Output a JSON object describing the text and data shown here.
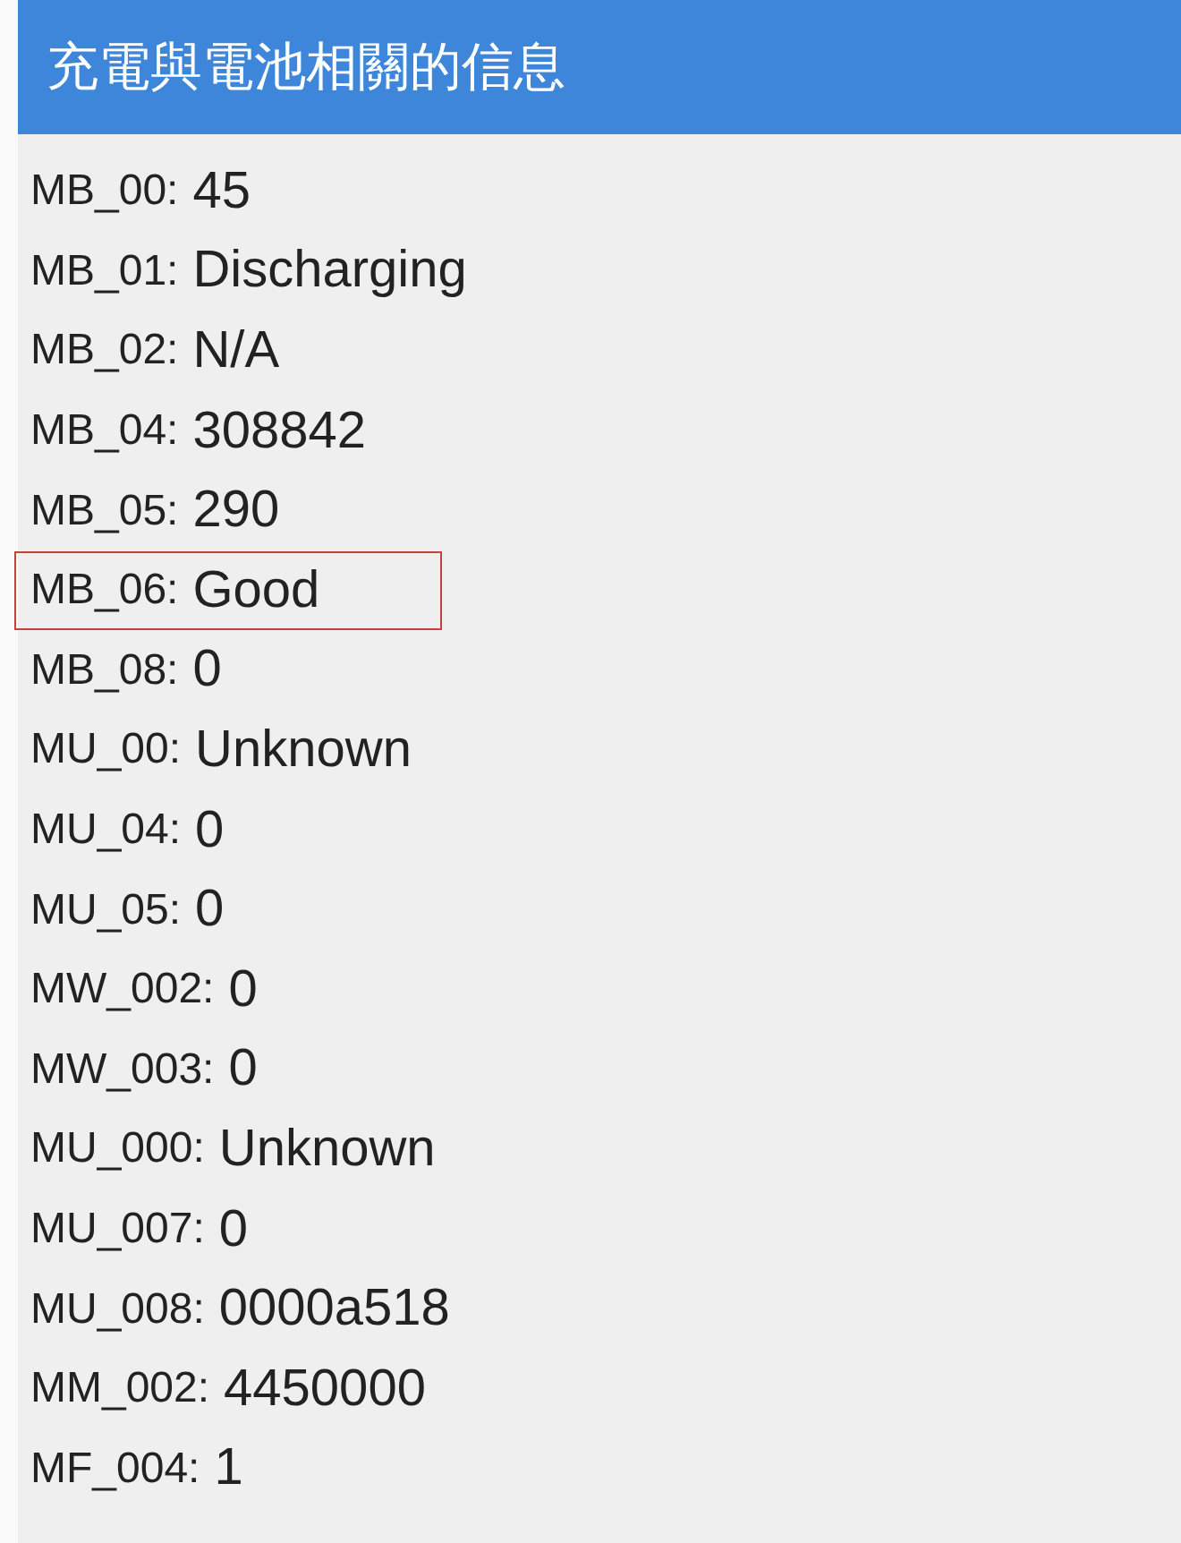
{
  "header": {
    "title": "充電與電池相關的信息"
  },
  "rows": [
    {
      "key": "MB_00:",
      "value": "45",
      "highlighted": false
    },
    {
      "key": "MB_01:",
      "value": "Discharging",
      "highlighted": false
    },
    {
      "key": "MB_02:",
      "value": "N/A",
      "highlighted": false
    },
    {
      "key": "MB_04:",
      "value": "308842",
      "highlighted": false
    },
    {
      "key": "MB_05:",
      "value": "290",
      "highlighted": false
    },
    {
      "key": "MB_06:",
      "value": "Good",
      "highlighted": true
    },
    {
      "key": "MB_08:",
      "value": "0",
      "highlighted": false
    },
    {
      "key": "MU_00:",
      "value": "Unknown",
      "highlighted": false
    },
    {
      "key": "MU_04:",
      "value": "0",
      "highlighted": false
    },
    {
      "key": "MU_05:",
      "value": "0",
      "highlighted": false
    },
    {
      "key": "MW_002:",
      "value": "0",
      "highlighted": false
    },
    {
      "key": "MW_003:",
      "value": "0",
      "highlighted": false
    },
    {
      "key": "MU_000:",
      "value": "Unknown",
      "highlighted": false
    },
    {
      "key": "MU_007:",
      "value": "0",
      "highlighted": false
    },
    {
      "key": "MU_008:",
      "value": "0000a518",
      "highlighted": false
    },
    {
      "key": "MM_002:",
      "value": "4450000",
      "highlighted": false
    },
    {
      "key": "MF_004:",
      "value": "1",
      "highlighted": false
    }
  ]
}
